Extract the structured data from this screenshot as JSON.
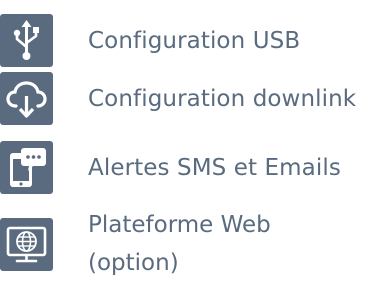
{
  "features": [
    {
      "icon": "usb-icon",
      "label": "Configuration USB"
    },
    {
      "icon": "cloud-download-icon",
      "label": "Configuration downlink"
    },
    {
      "icon": "phone-sms-icon",
      "label": "Alertes SMS et Emails"
    },
    {
      "icon": "web-monitor-globe-icon",
      "label_line1": "Plateforme Web",
      "label_line2": "(option)"
    }
  ],
  "colors": {
    "icon_bg": "#5a6b80",
    "icon_fg": "#ffffff",
    "text": "#5a6b80"
  }
}
